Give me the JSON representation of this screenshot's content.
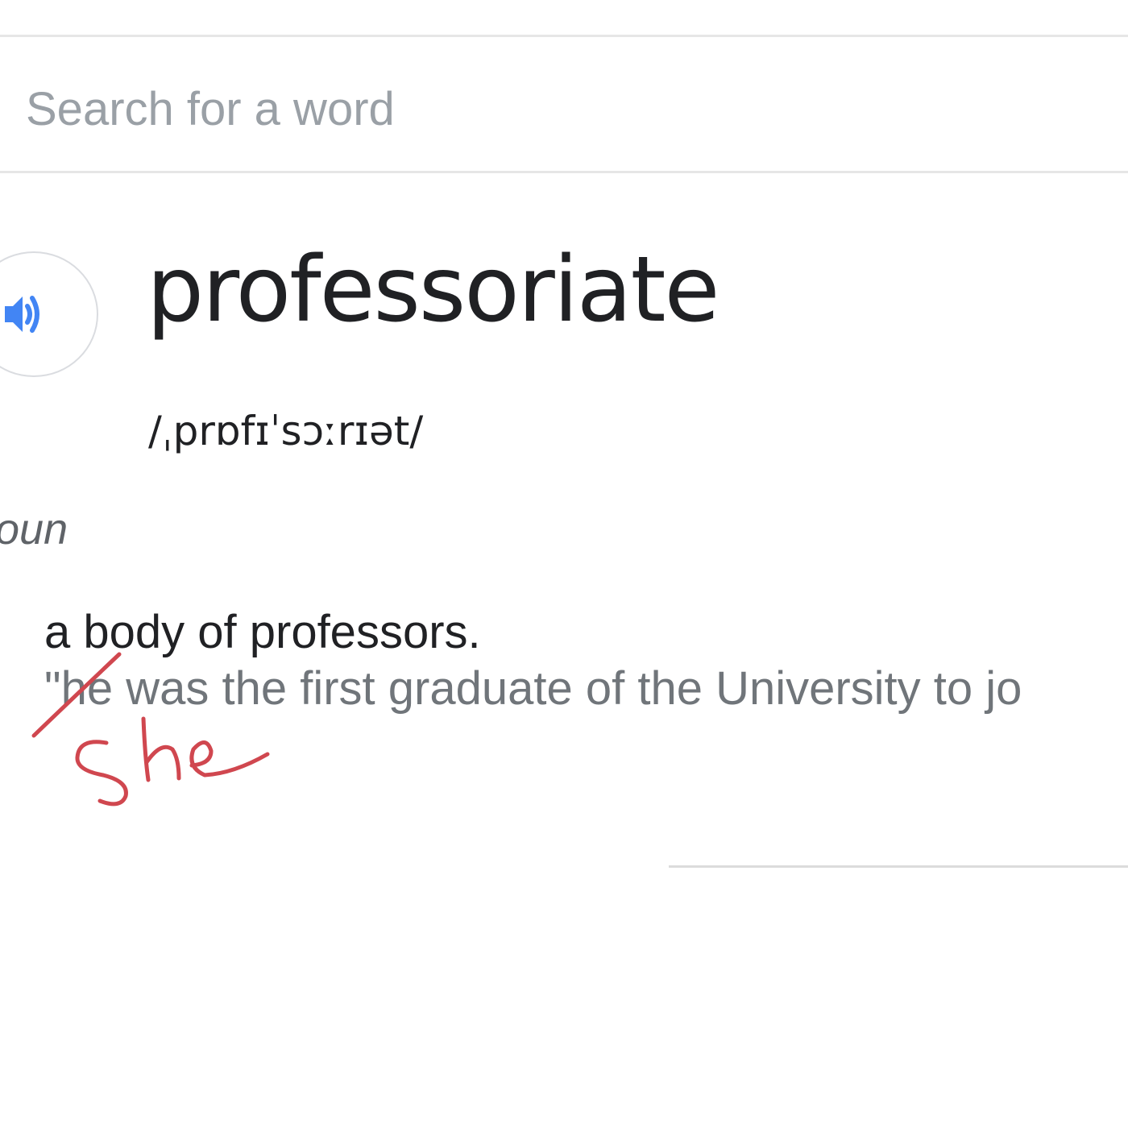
{
  "search": {
    "placeholder": "Search for a word",
    "value": ""
  },
  "entry": {
    "audio_icon": "speaker-icon",
    "headword": "professoriate",
    "phonetic": "/ˌprɒfɪˈsɔːrɪət/",
    "part_of_speech": "oun",
    "definition": "a body of professors.",
    "example": "\"he was the first graduate of the University to jo"
  },
  "annotation": {
    "handwritten_text": "She",
    "color": "#d0474f"
  },
  "colors": {
    "accent": "#4285f4",
    "text_primary": "#202124",
    "text_secondary": "#70757a"
  }
}
